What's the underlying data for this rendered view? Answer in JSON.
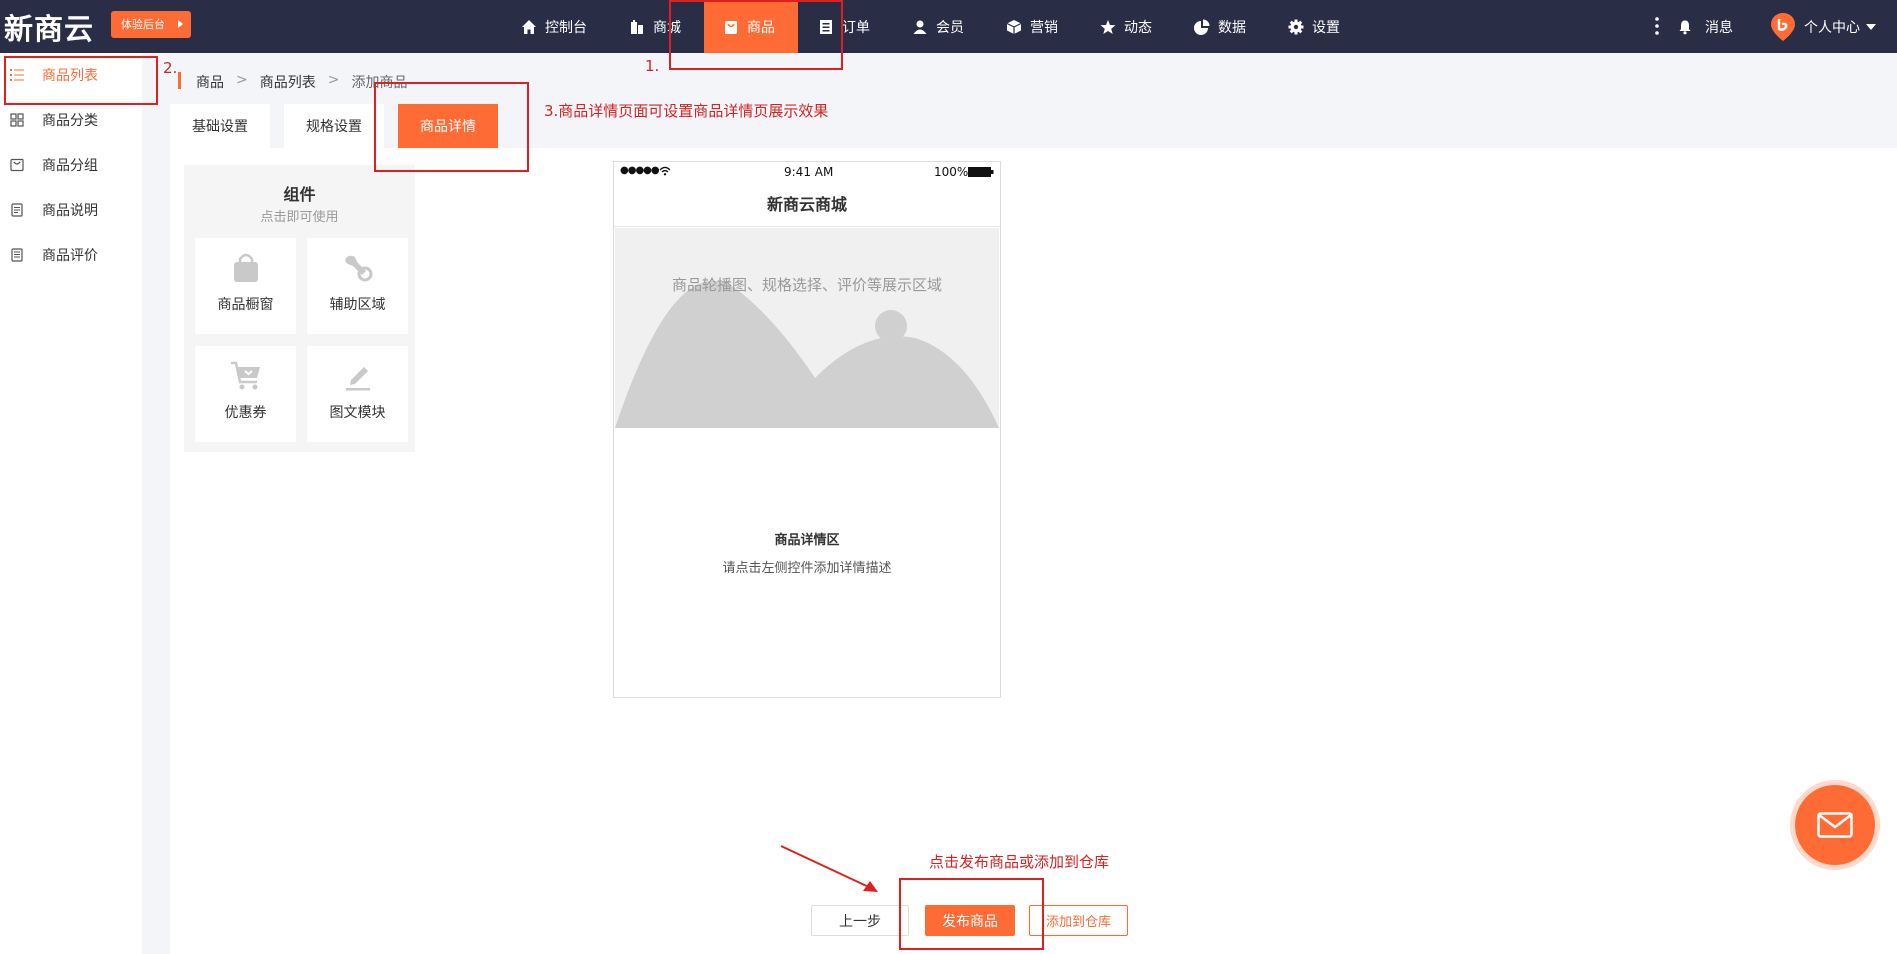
{
  "header": {
    "logo": "新商云",
    "trial_button": "体验后台",
    "nav": [
      {
        "label": "控制台",
        "icon": "home-icon"
      },
      {
        "label": "商城",
        "icon": "building-icon"
      },
      {
        "label": "商品",
        "icon": "shopping-bag-icon",
        "active": true
      },
      {
        "label": "订单",
        "icon": "document-icon"
      },
      {
        "label": "会员",
        "icon": "user-icon"
      },
      {
        "label": "营销",
        "icon": "cube-icon"
      },
      {
        "label": "动态",
        "icon": "star-icon"
      },
      {
        "label": "数据",
        "icon": "pie-chart-icon"
      },
      {
        "label": "设置",
        "icon": "gear-icon"
      }
    ],
    "messages": "消息",
    "profile": "个人中心"
  },
  "sidebar": {
    "items": [
      {
        "label": "商品列表",
        "icon": "list-icon",
        "active": true
      },
      {
        "label": "商品分类",
        "icon": "grid-icon"
      },
      {
        "label": "商品分组",
        "icon": "folder-icon"
      },
      {
        "label": "商品说明",
        "icon": "note-icon"
      },
      {
        "label": "商品评价",
        "icon": "review-icon"
      }
    ]
  },
  "breadcrumb": {
    "items": [
      "商品",
      "商品列表",
      "添加商品"
    ],
    "separator": ">"
  },
  "tabs": [
    {
      "label": "基础设置"
    },
    {
      "label": "规格设置"
    },
    {
      "label": "商品详情",
      "active": true
    }
  ],
  "components": {
    "title": "组件",
    "subtitle": "点击即可使用",
    "items": [
      {
        "label": "商品橱窗",
        "icon": "shopping-bag-icon"
      },
      {
        "label": "辅助区域",
        "icon": "wrench-icon"
      },
      {
        "label": "优惠券",
        "icon": "cart-icon"
      },
      {
        "label": "图文模块",
        "icon": "edit-icon"
      }
    ]
  },
  "phone": {
    "signal": "●●●●●",
    "time": "9:41 AM",
    "battery": "100%",
    "title": "新商云商城",
    "banner_text": "商品轮播图、规格选择、评价等展示区域",
    "detail_title": "商品详情区",
    "detail_hint": "请点击左侧控件添加详情描述"
  },
  "actions": {
    "prev": "上一步",
    "publish": "发布商品",
    "warehouse": "添加到仓库"
  },
  "annotations": {
    "step1": "1.",
    "step2": "2.",
    "step3": "3.商品详情页面可设置商品详情页展示效果",
    "publish_hint": "点击发布商品或添加到仓库"
  },
  "colors": {
    "accent": "#ff6b35",
    "topbar": "#2a2d46",
    "annotation": "#e02020"
  }
}
